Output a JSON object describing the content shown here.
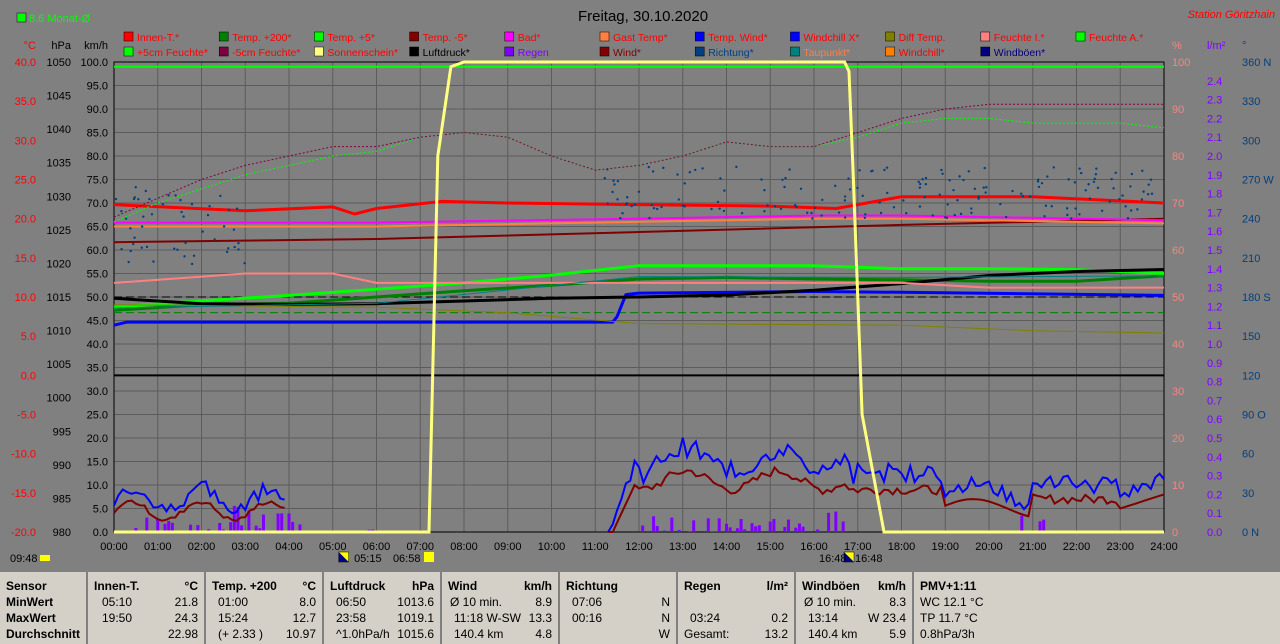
{
  "header": {
    "title": "Freitag, 30.10.2020",
    "station": "Station Göritzhain",
    "monthly_avg": "8.6 Monat-Ø"
  },
  "colors": {
    "background": "#808080",
    "grid": "#000000",
    "footer_bg": "#d4d0c8"
  },
  "legend": [
    {
      "label": "Innen-T.*",
      "color": "#ff0000",
      "text_color": "#ff0000"
    },
    {
      "label": "Temp. +200*",
      "color": "#008000",
      "text_color": "#ff0000"
    },
    {
      "label": "Temp. +5*",
      "color": "#00ff00",
      "text_color": "#ff0000"
    },
    {
      "label": "Temp. -5*",
      "color": "#800000",
      "text_color": "#ff0000"
    },
    {
      "label": "Bad*",
      "color": "#ff00ff",
      "text_color": "#ff0000"
    },
    {
      "label": "Gast Temp*",
      "color": "#ff8040",
      "text_color": "#ff0000"
    },
    {
      "label": "Temp. Wind*",
      "color": "#0000ff",
      "text_color": "#ff0000"
    },
    {
      "label": "Windchill X*",
      "color": "#0000ff",
      "text_color": "#ff0000"
    },
    {
      "label": "Diff Temp.",
      "color": "#808000",
      "text_color": "#ff0000"
    },
    {
      "label": "Feuchte I.*",
      "color": "#ff8080",
      "text_color": "#ff0000"
    },
    {
      "label": "Feuchte A.*",
      "color": "#00ff00",
      "text_color": "#ff0000"
    },
    {
      "label": "+5cm Feuchte*",
      "color": "#00ff00",
      "text_color": "#ff0000"
    },
    {
      "label": "-5cm Feuchte*",
      "color": "#800040",
      "text_color": "#ff0000"
    },
    {
      "label": "Sonnenschein*",
      "color": "#ffff80",
      "text_color": "#ff0000"
    },
    {
      "label": "Luftdruck*",
      "color": "#000000",
      "text_color": "#000000"
    },
    {
      "label": "Regen",
      "color": "#8000ff",
      "text_color": "#8000ff"
    },
    {
      "label": "Wind*",
      "color": "#800000",
      "text_color": "#800000"
    },
    {
      "label": "Richtung*",
      "color": "#004080",
      "text_color": "#004080"
    },
    {
      "label": "Taupunkt*",
      "color": "#008080",
      "text_color": "#ff8040"
    },
    {
      "label": "Windchill*",
      "color": "#ff8000",
      "text_color": "#ff0000"
    },
    {
      "label": "Windböen*",
      "color": "#000080",
      "text_color": "#000080"
    }
  ],
  "chart_data": {
    "type": "line",
    "title": "Freitag, 30.10.2020",
    "x_ticks": [
      "00:00",
      "01:00",
      "02:00",
      "03:00",
      "04:00",
      "05:00",
      "06:00",
      "07:00",
      "08:00",
      "09:00",
      "10:00",
      "11:00",
      "12:00",
      "13:00",
      "14:00",
      "15:00",
      "16:00",
      "17:00",
      "18:00",
      "19:00",
      "20:00",
      "21:00",
      "22:00",
      "23:00",
      "24:00"
    ],
    "xlim": [
      0,
      24
    ],
    "axes": {
      "temp": {
        "unit": "°C",
        "range": [
          -20,
          40
        ],
        "ticks": [
          "40.0",
          "35.0",
          "30.0",
          "25.0",
          "20.0",
          "15.0",
          "10.0",
          "5.0",
          "0.0",
          "-5.0",
          "-10.0",
          "-15.0",
          "-20.0"
        ],
        "color": "#ff0000"
      },
      "pressure": {
        "unit": "hPa",
        "range": [
          980,
          1050
        ],
        "ticks": [
          "1050",
          "1045",
          "1040",
          "1035",
          "1030",
          "1025",
          "1020",
          "1015",
          "1010",
          "1005",
          "1000",
          "995",
          "990",
          "985",
          "980"
        ],
        "color": "#000000"
      },
      "wind": {
        "unit": "km/h",
        "range": [
          0,
          100
        ],
        "ticks": [
          "100.0",
          "95.0",
          "90.0",
          "85.0",
          "80.0",
          "75.0",
          "70.0",
          "65.0",
          "60.0",
          "55.0",
          "50.0",
          "45.0",
          "40.0",
          "35.0",
          "30.0",
          "25.0",
          "20.0",
          "15.0",
          "10.0",
          "5.0",
          "0.0"
        ],
        "color": "#000000"
      },
      "humidity": {
        "unit": "%",
        "range": [
          0,
          100
        ],
        "ticks": [
          "100",
          "90",
          "80",
          "70",
          "60",
          "50",
          "40",
          "30",
          "20",
          "10",
          "0"
        ],
        "color": "#ff8080"
      },
      "rain": {
        "unit": "l/m²",
        "range": [
          0,
          2.5
        ],
        "ticks": [
          "2.4",
          "2.3",
          "2.2",
          "2.1",
          "2.0",
          "1.9",
          "1.8",
          "1.7",
          "1.6",
          "1.5",
          "1.4",
          "1.3",
          "1.2",
          "1.1",
          "1.0",
          "0.9",
          "0.8",
          "0.7",
          "0.6",
          "0.5",
          "0.4",
          "0.3",
          "0.2",
          "0.1",
          "0.0"
        ],
        "color": "#8000ff"
      },
      "direction": {
        "unit": "°",
        "range": [
          0,
          360
        ],
        "ticks": [
          "360 N",
          "330",
          "300",
          "270 W",
          "240",
          "210",
          "180 S",
          "150",
          "120",
          "90 O",
          "60",
          "30",
          "0 N"
        ],
        "color": "#004080"
      }
    },
    "series": [
      {
        "name": "Innen-T.*",
        "axis": "temp",
        "color": "#ff0000",
        "width": 3,
        "x": [
          0,
          3,
          5,
          5.5,
          6,
          7.5,
          9,
          12,
          15,
          16.5,
          17,
          18,
          21,
          24
        ],
        "y": [
          21.8,
          21.0,
          21.5,
          20.6,
          21.3,
          22.2,
          22.0,
          21.8,
          21.6,
          21.3,
          21.8,
          22.8,
          22.8,
          22.0
        ]
      },
      {
        "name": "Temp. +200*",
        "axis": "temp",
        "color": "#008000",
        "width": 3,
        "x": [
          0,
          2,
          4,
          6,
          8,
          10,
          12,
          14,
          16,
          18,
          20,
          22,
          24
        ],
        "y": [
          8.3,
          9.0,
          9.2,
          10.0,
          10.8,
          11.5,
          12.3,
          12.5,
          12.3,
          12.2,
          12.0,
          12.0,
          12.7
        ]
      },
      {
        "name": "Temp. +5*",
        "axis": "temp",
        "color": "#00ff00",
        "width": 3,
        "x": [
          0,
          2,
          4,
          6,
          8,
          10,
          12,
          14,
          16,
          17,
          18,
          20,
          22,
          24
        ],
        "y": [
          8.7,
          9.5,
          10.2,
          11.0,
          11.8,
          12.8,
          14.0,
          14.0,
          14.0,
          13.8,
          13.6,
          13.6,
          13.5,
          13.0
        ]
      },
      {
        "name": "Temp. -5*",
        "axis": "temp",
        "color": "#800000",
        "width": 2,
        "x": [
          0,
          6,
          12,
          18,
          24
        ],
        "y": [
          17.0,
          17.4,
          18.3,
          19.2,
          20.0
        ]
      },
      {
        "name": "Bad*",
        "axis": "temp",
        "color": "#ff00ff",
        "width": 2,
        "x": [
          0,
          6,
          12,
          16,
          18,
          24
        ],
        "y": [
          19.5,
          19.5,
          20.0,
          20.4,
          20.4,
          19.8
        ]
      },
      {
        "name": "Gast Temp*",
        "axis": "temp",
        "color": "#ff8040",
        "width": 2,
        "x": [
          0,
          6,
          12,
          16,
          18,
          24
        ],
        "y": [
          19.0,
          19.0,
          19.6,
          20.0,
          20.0,
          19.4
        ]
      },
      {
        "name": "Temp. Wind*",
        "axis": "temp",
        "color": "#0000ff",
        "width": 3,
        "x": [
          0,
          0.3,
          11.4,
          11.5,
          11.7,
          12,
          16,
          18,
          24
        ],
        "y": [
          6.4,
          6.8,
          6.8,
          7.5,
          10.3,
          10.5,
          10.7,
          10.6,
          10.2
        ]
      },
      {
        "name": "Luftdruck*",
        "axis": "pressure",
        "color": "#000000",
        "width": 3,
        "x": [
          0,
          2,
          4,
          6,
          8,
          10,
          12,
          14,
          16,
          18,
          20,
          22,
          24
        ],
        "y": [
          1014.8,
          1014.0,
          1013.9,
          1014.0,
          1014.4,
          1014.8,
          1015.0,
          1015.3,
          1016.0,
          1017.0,
          1018.2,
          1018.8,
          1019.1
        ]
      },
      {
        "name": "Feuchte I.*",
        "axis": "humidity",
        "color": "#ff8080",
        "width": 2,
        "x": [
          0,
          3,
          5,
          6,
          8,
          12,
          16,
          18,
          20,
          24
        ],
        "y": [
          53,
          55,
          55,
          53,
          53,
          53,
          53,
          53,
          52,
          52
        ]
      },
      {
        "name": "+5cm Feuchte*",
        "axis": "humidity",
        "color": "#00ff00",
        "width": 1,
        "dash": "2,2",
        "x": [
          0,
          1,
          2,
          3,
          4,
          5,
          6,
          7,
          8,
          9,
          10,
          11,
          12,
          13,
          14,
          15,
          16,
          17,
          18,
          19,
          20,
          21,
          22,
          23,
          24
        ],
        "y": [
          66,
          70,
          73,
          76,
          78,
          80,
          81,
          84,
          85,
          84,
          80,
          77,
          78,
          80,
          83,
          82,
          82,
          84,
          87,
          88,
          88,
          87,
          87,
          87,
          86
        ]
      },
      {
        "name": "-5cm Feuchte*",
        "axis": "humidity",
        "color": "#800040",
        "width": 1,
        "dash": "2,2",
        "x": [
          0,
          1,
          2,
          3,
          4,
          5,
          6,
          7,
          8,
          9,
          10,
          11,
          12,
          13,
          14,
          15,
          16,
          17,
          18,
          19,
          20,
          21,
          22,
          23,
          24
        ],
        "y": [
          67,
          71,
          75,
          78,
          80,
          82,
          82,
          84,
          85,
          84,
          80,
          77,
          78,
          80,
          83,
          82,
          82,
          85,
          88,
          90,
          91,
          91,
          91,
          91,
          91
        ]
      },
      {
        "name": "Diff Temp.",
        "axis": "temp",
        "color": "#808000",
        "width": 1,
        "x": [
          0,
          6,
          9,
          12,
          15,
          18,
          21,
          24
        ],
        "y": [
          9.0,
          8.7,
          8.0,
          6.6,
          6.5,
          6.4,
          5.7,
          5.4
        ]
      },
      {
        "name": "Taupunkt*",
        "axis": "temp",
        "color": "#008080",
        "width": 1,
        "x": [
          0,
          6,
          12,
          18,
          24
        ],
        "y": [
          8.6,
          9.2,
          12.6,
          12.5,
          12.7
        ]
      }
    ],
    "sunshine": {
      "name": "Sonnenschein*",
      "axis": "humidity",
      "color": "#ffff80",
      "x": [
        0,
        7.2,
        7.4,
        7.7,
        8,
        16.7,
        16.8,
        16.9,
        17.1,
        17.6,
        24
      ],
      "y": [
        0,
        0,
        80,
        99,
        100,
        100,
        98,
        75,
        25,
        0,
        0
      ]
    },
    "bars": {
      "name": "Regen",
      "axis": "wind",
      "color": "#8000ff"
    },
    "reference_lines": [
      {
        "axis": "humidity",
        "value": 99,
        "color": "#00ff00"
      },
      {
        "axis": "temp",
        "value": 0,
        "color": "#000000"
      }
    ],
    "wind_series": [
      {
        "name": "Wind*",
        "axis": "wind",
        "color": "#800000",
        "width": 2
      },
      {
        "name": "Windböen*",
        "axis": "wind",
        "color": "#0000ff",
        "width": 2
      }
    ],
    "direction_scatter": {
      "name": "Richtung*",
      "axis": "direction",
      "color": "#004080"
    }
  },
  "sun_marks": {
    "rise": "05:15",
    "twilight_morning": "06:58",
    "twilight_evening": "16:48",
    "set": "16:48",
    "current_time": "09:48"
  },
  "footer": {
    "sensor": {
      "label": "Sensor",
      "rows": [
        "MinWert",
        "MaxWert",
        "Durchschnitt"
      ]
    },
    "innen": {
      "title": "Innen-T.",
      "unit": "°C",
      "rows": [
        [
          "05:10",
          "21.8"
        ],
        [
          "19:50",
          "24.3"
        ],
        [
          "",
          "22.98"
        ]
      ]
    },
    "temp200": {
      "title": "Temp. +200",
      "unit": "°C",
      "rows": [
        [
          "01:00",
          "8.0"
        ],
        [
          "15:24",
          "12.7"
        ],
        [
          "(+ 2.33 )",
          "10.97"
        ]
      ]
    },
    "luftdruck": {
      "title": "Luftdruck",
      "unit": "hPa",
      "rows": [
        [
          "06:50",
          "1013.6"
        ],
        [
          "23:58",
          "1019.1"
        ],
        [
          "^1.0hPa/h",
          "1015.6"
        ]
      ]
    },
    "wind": {
      "title": "Wind",
      "unit": "km/h",
      "rows": [
        [
          "Ø 10 min.",
          "8.9"
        ],
        [
          "11:18   W-SW",
          "13.3"
        ],
        [
          "140.4 km",
          "4.8"
        ]
      ]
    },
    "richtung": {
      "title": "Richtung",
      "unit": "",
      "rows": [
        [
          "07:06",
          "N"
        ],
        [
          "00:16",
          "N"
        ],
        [
          "",
          "W"
        ]
      ]
    },
    "regen": {
      "title": "Regen",
      "unit": "l/m²",
      "rows": [
        [
          "",
          ""
        ],
        [
          "03:24",
          "0.2"
        ],
        [
          "Gesamt:",
          "13.2"
        ]
      ]
    },
    "boeen": {
      "title": "Windböen",
      "unit": "km/h",
      "rows": [
        [
          "Ø 10 min.",
          "8.3"
        ],
        [
          "13:14",
          "W 23.4"
        ],
        [
          "140.4 km",
          "5.9"
        ]
      ]
    },
    "pmv": {
      "title": "PMV+1:11",
      "unit": "",
      "rows": [
        [
          "WC 12.1 °C",
          ""
        ],
        [
          "TP 11.7 °C",
          ""
        ],
        [
          "0.8hPa/3h",
          ""
        ]
      ]
    }
  }
}
